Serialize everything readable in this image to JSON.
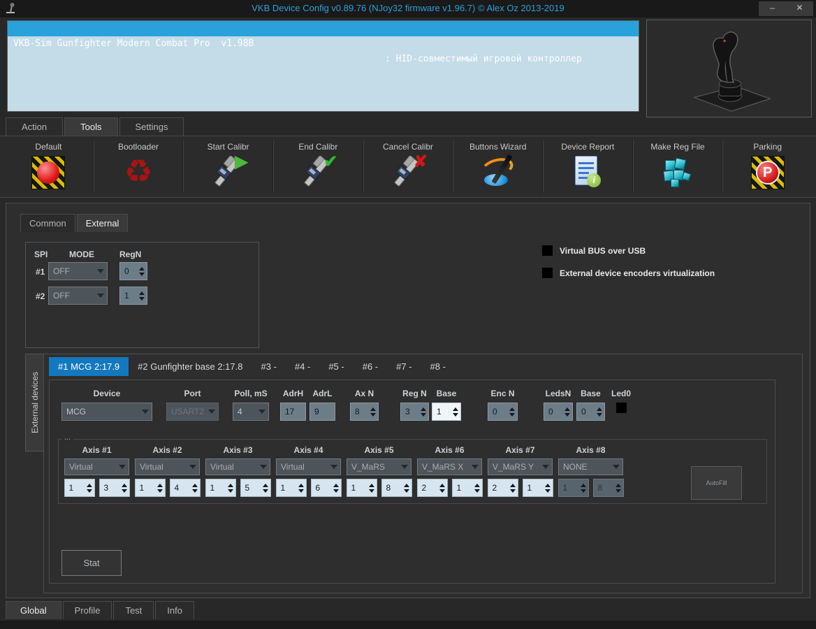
{
  "window": {
    "title": "VKB Device Config v0.89.76 (NJoy32 firmware v1.96.7) © Alex Oz 2013-2019",
    "minimize": "–",
    "close": "✕"
  },
  "device_list": {
    "selected_row": {
      "name": "VKB-Sim Gunfighter Modern Combat Pro  v1.98B",
      "type": ": HID-совместимый игровой контроллер"
    }
  },
  "main_tabs": [
    {
      "label": "Action"
    },
    {
      "label": "Tools"
    },
    {
      "label": "Settings"
    }
  ],
  "toolbar": {
    "buttons": [
      {
        "label": "Default"
      },
      {
        "label": "Bootloader"
      },
      {
        "label": "Start Calibr"
      },
      {
        "label": "End Calibr"
      },
      {
        "label": "Cancel Calibr"
      },
      {
        "label": "Buttons Wizard"
      },
      {
        "label": "Device Report"
      },
      {
        "label": "Make Reg File"
      },
      {
        "label": "Parking"
      }
    ],
    "icon_glyphs": {
      "play": "▶",
      "check": "✔",
      "cancel": "✘",
      "recycle": "♻",
      "info": "i",
      "parking": "P"
    }
  },
  "config_tabs": [
    {
      "label": "Common"
    },
    {
      "label": "External"
    }
  ],
  "spi": {
    "title": "SPI",
    "mode_header": "MODE",
    "regn_header": "RegN",
    "rows": [
      {
        "id": "#1",
        "mode": "OFF",
        "regn": "0"
      },
      {
        "id": "#2",
        "mode": "OFF",
        "regn": "1"
      }
    ]
  },
  "options": {
    "virtual_bus": "Virtual BUS over USB",
    "encoder_virt": "External device encoders virtualization"
  },
  "external": {
    "side_tab": "External devices",
    "device_tabs": [
      {
        "label": "#1 MCG 2:17.9"
      },
      {
        "label": "#2 Gunfighter base 2:17.8"
      },
      {
        "label": "#3 -"
      },
      {
        "label": "#4 -"
      },
      {
        "label": "#5 -"
      },
      {
        "label": "#6 -"
      },
      {
        "label": "#7 -"
      },
      {
        "label": "#8 -"
      }
    ],
    "device": {
      "device_label": "Device",
      "device": "MCG",
      "port_label": "Port",
      "port": "USART2",
      "poll_label": "Poll, mS",
      "poll": "4",
      "adrh_label": "AdrH",
      "adrh": "17",
      "adrl_label": "AdrL",
      "adrl": "9",
      "axn_label": "Ax N",
      "axn": "8",
      "regn_label": "Reg N",
      "regn": "3",
      "base_label": "Base",
      "base": "1",
      "encn_label": "Enc N",
      "encn": "0",
      "ledsn_label": "LedsN",
      "ledsn": "0",
      "base2_label": "Base",
      "base2": "0",
      "led0_label": "Led0"
    },
    "axis_group_label": "...",
    "axes": [
      {
        "label": "Axis #1",
        "mode": "Virtual",
        "v1": "1",
        "v2": "3"
      },
      {
        "label": "Axis #2",
        "mode": "Virtual",
        "v1": "1",
        "v2": "4"
      },
      {
        "label": "Axis #3",
        "mode": "Virtual",
        "v1": "1",
        "v2": "5"
      },
      {
        "label": "Axis #4",
        "mode": "Virtual",
        "v1": "1",
        "v2": "6"
      },
      {
        "label": "Axis #5",
        "mode": "V_MaRS",
        "v1": "1",
        "v2": "8"
      },
      {
        "label": "Axis #6",
        "mode": "V_MaRS X",
        "v1": "2",
        "v2": "1"
      },
      {
        "label": "Axis #7",
        "mode": "V_MaRS Y",
        "v1": "2",
        "v2": "1"
      },
      {
        "label": "Axis #8",
        "mode": "NONE",
        "v1": "1",
        "v2": "8"
      }
    ],
    "autofill": "AutoFill",
    "stat": "Stat"
  },
  "bottom_tabs": [
    {
      "label": "Global"
    },
    {
      "label": "Profile"
    },
    {
      "label": "Test"
    },
    {
      "label": "Info"
    }
  ],
  "colors": {
    "accent": "#1478be",
    "selection": "#29a2dc",
    "title_text": "#2da0d8",
    "list_bg": "#c3dce8"
  }
}
